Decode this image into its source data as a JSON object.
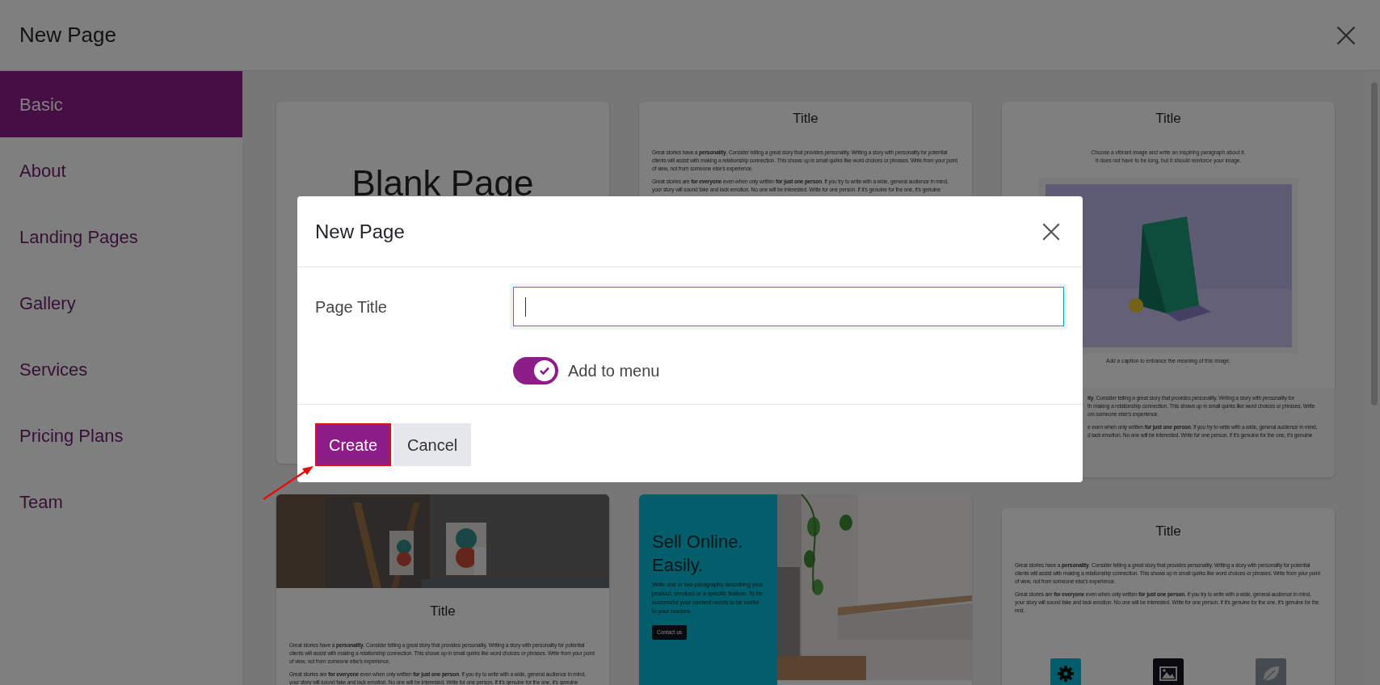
{
  "window": {
    "title": "New Page"
  },
  "sidebar": {
    "items": [
      {
        "label": "Basic",
        "selected": true
      },
      {
        "label": "About",
        "selected": false
      },
      {
        "label": "Landing Pages",
        "selected": false
      },
      {
        "label": "Gallery",
        "selected": false
      },
      {
        "label": "Services",
        "selected": false
      },
      {
        "label": "Pricing Plans",
        "selected": false
      },
      {
        "label": "Team",
        "selected": false
      }
    ]
  },
  "template_columns": [
    {
      "templates": [
        {
          "kind": "blank",
          "heading": "Blank Page"
        },
        {
          "kind": "cover_text",
          "title": "Title",
          "paragraphs": [
            "Great stories have a **personality**. Consider telling a great story that provides personality. Writing a story with personality for potential clients will assist with making a relationship connection. This shows up in small quirks like word choices or phrases. Write from your point of view, not from someone else's experience.",
            "Great stories are **for everyone** even when only written **for just one person**. If you try to write with a wide, general audience in mind, your story will sound fake and lack emotion. No one will be interested. Write for one person. If it's genuine for the one, it's genuine"
          ]
        }
      ]
    },
    {
      "templates": [
        {
          "kind": "text",
          "title": "Title",
          "paragraphs": [
            "Great stories have a **personality**. Consider telling a great story that provides personality. Writing a story with personality for potential clients will assist with making a relationship connection. This shows up in small quirks like word choices or phrases. Write from your point of view, not from someone else's experience.",
            "Great stories are **for everyone** even when only written **for just one person**. If you try to write with a wide, general audience in mind, your story will sound fake and lack emotion. No one will be interested. Write for one person. If it's genuine for the one, it's genuine"
          ]
        },
        {
          "kind": "split_promo",
          "heading": "Sell Online. Easily.",
          "paragraph": "Write one or two paragraphs describing your product, services or a specific feature. To be successful your content needs to be useful to your readers.",
          "button": "Contact us"
        }
      ]
    },
    {
      "templates": [
        {
          "kind": "image_caption",
          "title": "Title",
          "intro": [
            "Choose a vibrant image and write an inspiring paragraph about it.",
            "It does not have to be long, but it should reinforce your image."
          ],
          "caption": "Add a caption to enhance the meaning of this image.",
          "paragraph_fragments": [
            [
              "**ity**. Consider telling a great story that provides personality. Writing a story with personality for",
              "th making a relationship connection. This shows up in small quirks like word choices or phrases. Write",
              "om someone else's experience."
            ],
            [
              "e even when only written **for just one person**. If you try to write with a wide, general audience in mind,",
              "d lack emotion. No one will be interested. Write for one person. If it's genuine for the one, it's genuine"
            ]
          ]
        },
        {
          "kind": "text_icons",
          "title": "Title",
          "paragraphs": [
            "Great stories have a **personality**. Consider telling a great story that provides personality. Writing a story with personality for potential clients will assist with making a relationship connection. This shows up in small quirks like word choices or phrases. Write from your point of view, not from someone else's experience.",
            "Great stories are **for everyone** even when only written **for just one person**. If you try to write with a wide, general audience in mind, your story will sound fake and lack emotion. No one will be interested. Write for one person. If it's genuine for the one, it's genuine for the rest."
          ]
        }
      ]
    }
  ],
  "modal": {
    "title": "New Page",
    "field": {
      "label": "Page Title",
      "focused": true
    },
    "toggle": {
      "label": "Add to menu",
      "on": true
    },
    "buttons": [
      {
        "label": "Create",
        "kind": "primary",
        "highlighted": true
      },
      {
        "label": "Cancel",
        "kind": "secondary",
        "highlighted": false
      }
    ]
  }
}
